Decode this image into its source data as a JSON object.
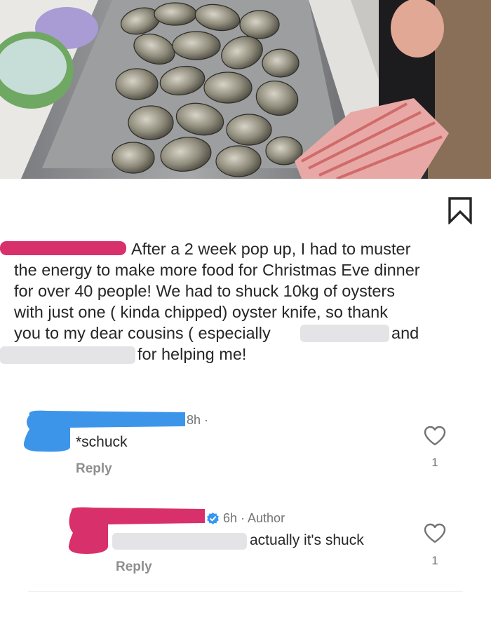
{
  "post": {
    "caption_lines": [
      "After a 2 week pop up, I had to muster",
      "the energy to make more food for Christmas Eve dinner",
      "for over 40 people! We had to shuck 10kg of oysters",
      "with just one ( kinda chipped)  oyster knife, so thank",
      "you to my dear cousins ( especially",
      "and",
      "for helping me!"
    ],
    "bookmark_icon": "bookmark-icon"
  },
  "comments": [
    {
      "time": "8h ·",
      "text": "*schuck",
      "reply_label": "Reply",
      "likes": "1",
      "is_author": false
    },
    {
      "time": "6h · Author",
      "text": "actually it's shuck",
      "reply_label": "Reply",
      "likes": "1",
      "is_author": true,
      "verified_color": "#3897f0"
    }
  ],
  "colors": {
    "redaction_pink": "#d8306b",
    "redaction_blue": "#3d95ea",
    "redaction_gray": "#e4e4e6",
    "text_primary": "#262626",
    "text_secondary": "#737373"
  }
}
